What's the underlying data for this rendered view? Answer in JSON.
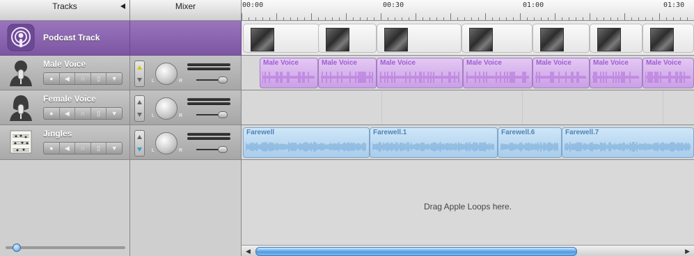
{
  "header": {
    "tracks_label": "Tracks",
    "mixer_label": "Mixer",
    "ruler_times": [
      "00:00",
      "00:30",
      "01:00",
      "01:30"
    ]
  },
  "tracks": [
    {
      "name": "Podcast Track"
    },
    {
      "name": "Male Voice"
    },
    {
      "name": "Female Voice"
    },
    {
      "name": "Jingles"
    }
  ],
  "male_regions": [
    "Male Voice",
    "Male Voice",
    "Male Voice",
    "Male Voice",
    "Male Voice",
    "Male Voice",
    "Male Voice"
  ],
  "jingle_regions": [
    "Farewell",
    "Farewell.1",
    "Farewell.6",
    "Farewell.7"
  ],
  "drop_hint": "Drag Apple Loops here.",
  "colors": {
    "podcast_purple": "#8a63ad",
    "voice_region": "#d7b6ee",
    "jingle_region": "#bcdaf2",
    "scroll_blue": "#4f9be3"
  },
  "icons": {
    "record": "record-icon",
    "mute": "speaker-mute-icon",
    "solo": "headphones-icon",
    "lock": "lock-icon",
    "expand": "triangle-down-icon"
  }
}
